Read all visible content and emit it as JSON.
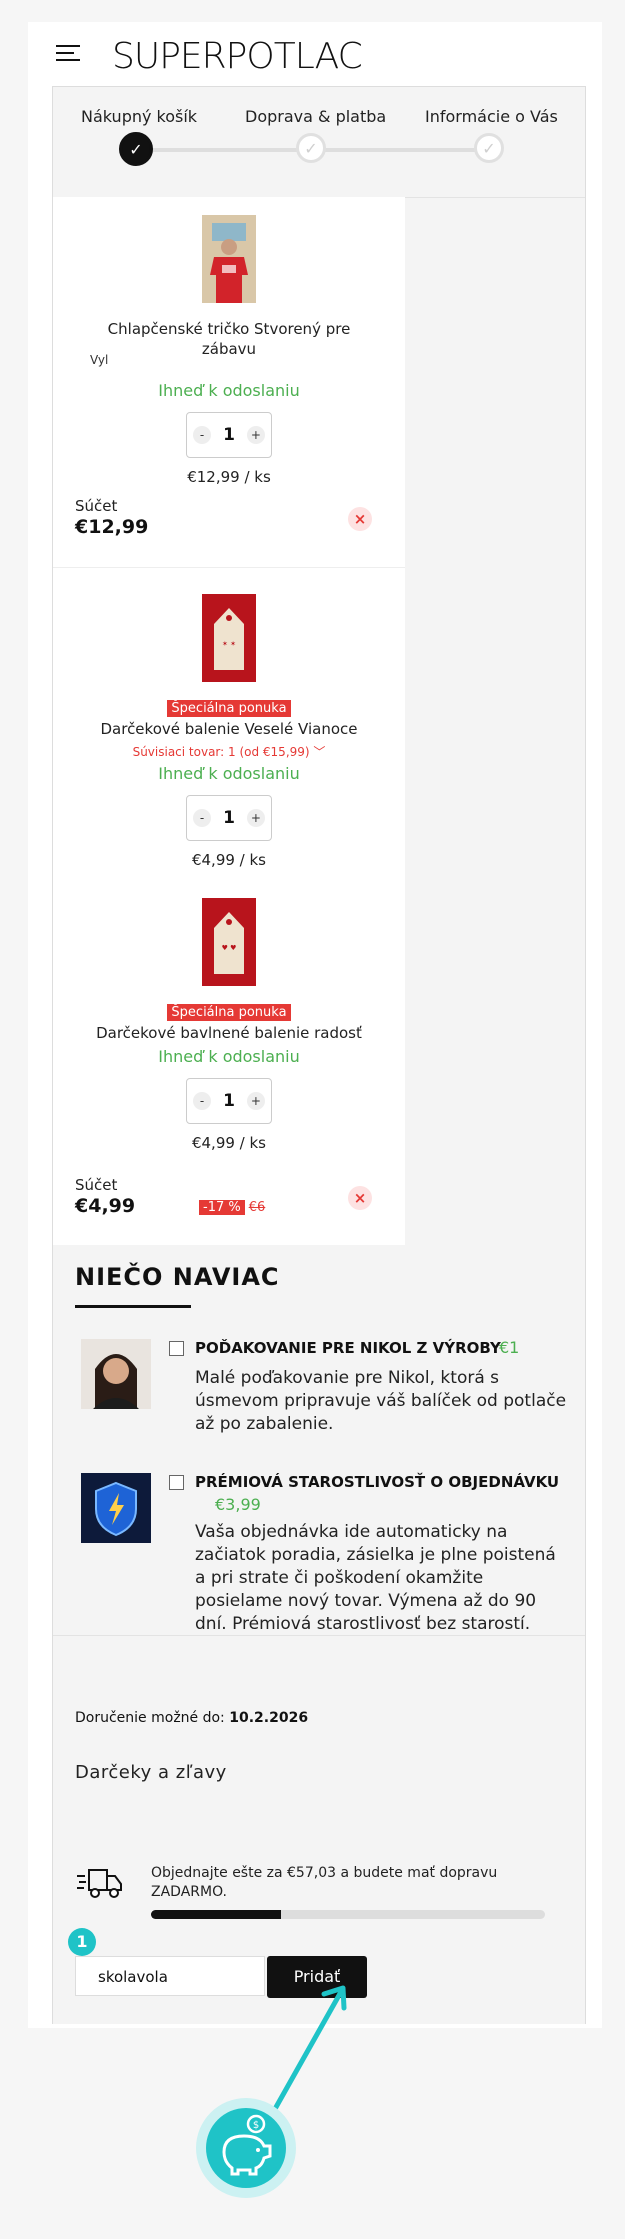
{
  "header": {
    "logo": "SUPERPOTLAC"
  },
  "steps": [
    {
      "label": "Nákupný košík",
      "active": true
    },
    {
      "label": "Doprava & platba",
      "active": false
    },
    {
      "label": "Informácie o Vás",
      "active": false
    }
  ],
  "items": [
    {
      "name": "Chlapčenské tričko Stvorený pre zábavu",
      "variant_label": "Vyl",
      "availability": "Ihneď k odoslaniu",
      "quantity": "1",
      "unit_price": "€12,99 / ks",
      "sum_label": "Súčet",
      "sum_value": "€12,99"
    },
    {
      "badge": "Špeciálna ponuka",
      "name": "Darčekové balenie Veselé Vianoce",
      "related": "Súvisiaci tovar: 1 (od €15,99)",
      "availability": "Ihneď k odoslaniu",
      "quantity": "1",
      "unit_price": "€4,99 / ks"
    },
    {
      "badge": "Špeciálna ponuka",
      "name": "Darčekové bavlnené balenie radosť",
      "availability": "Ihneď k odoslaniu",
      "quantity": "1",
      "unit_price": "€4,99 / ks",
      "sum_label": "Súčet",
      "sum_value": "€4,99",
      "discount": "-17 %",
      "old_price": "€6"
    }
  ],
  "extras": {
    "title": "NIEČO NAVIAC",
    "addons": [
      {
        "title": "POĎAKOVANIE PRE NIKOL Z VÝROBY",
        "price": "€1",
        "desc": "Malé poďakovanie pre Nikol, ktorá s úsmevom pripravuje váš balíček od potlače až po zabalenie."
      },
      {
        "title": "PRÉMIOVÁ STAROSTLIVOSŤ O OBJEDNÁVKU",
        "price": "€3,99",
        "desc": "Vaša objednávka ide automaticky na začiatok poradia, zásielka je plne poistená a pri strate či poškodení okamžite posielame nový tovar. Výmena až do 90 dní. Prémiová starostlivosť bez starostí."
      }
    ]
  },
  "summary": {
    "delivery_prefix": "Doručenie možné do:",
    "delivery_date": "10.2.2026",
    "gifts_label": "Darčeky a zľavy",
    "shipping_message": "Objednajte ešte za €57,03 a budete mať dopravu ZADARMO.",
    "shipping_progress": 0.33,
    "coupon_value": "skolavola",
    "coupon_button": "Pridať"
  },
  "annotation": {
    "number": "1"
  },
  "colors": {
    "accent": "#1fc3c7",
    "green": "#4caf50",
    "red": "#e53935"
  }
}
